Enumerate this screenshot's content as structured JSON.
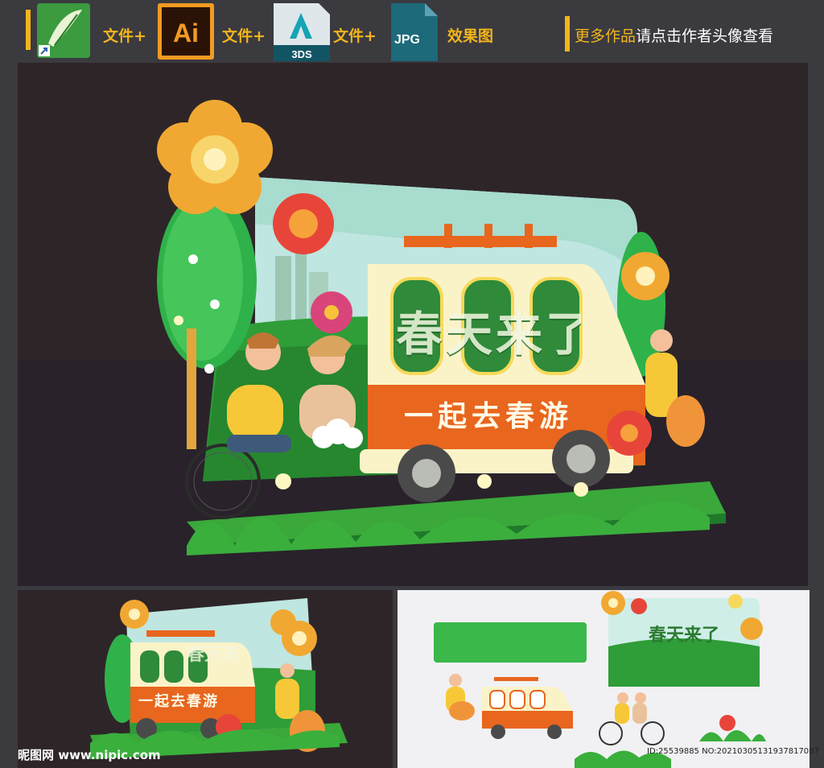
{
  "header": {
    "file_plus_1": "文件+",
    "file_plus_2": "文件+",
    "file_plus_3": "文件+",
    "effect_label": "效果图",
    "more_works_highlight": "更多作品",
    "more_works_rest": "请点击作者头像查看",
    "icons": [
      {
        "name": "coreldraw-icon",
        "letters": ""
      },
      {
        "name": "illustrator-icon",
        "letters": "Ai"
      },
      {
        "name": "3ds-max-icon",
        "letters": "3DS"
      },
      {
        "name": "jpg-file-icon",
        "letters": "JPG"
      }
    ]
  },
  "main_render": {
    "bus_slogan": "一起去春游",
    "window_text": "春天来了"
  },
  "thumb_left": {
    "bus_slogan": "一起去春游",
    "window_text": "春天来了"
  },
  "thumb_right": {
    "sign_text": "春天来了"
  },
  "footer": {
    "watermark": "昵图网 www.nipic.com",
    "id_line": "ID:25539885 NO:20210305131937817087"
  },
  "colors": {
    "accent": "#f2b51c",
    "background": "#3a3a3f",
    "bus_orange": "#e8661e",
    "bus_cream": "#fbf3c8",
    "grass": "#2fa63a"
  }
}
